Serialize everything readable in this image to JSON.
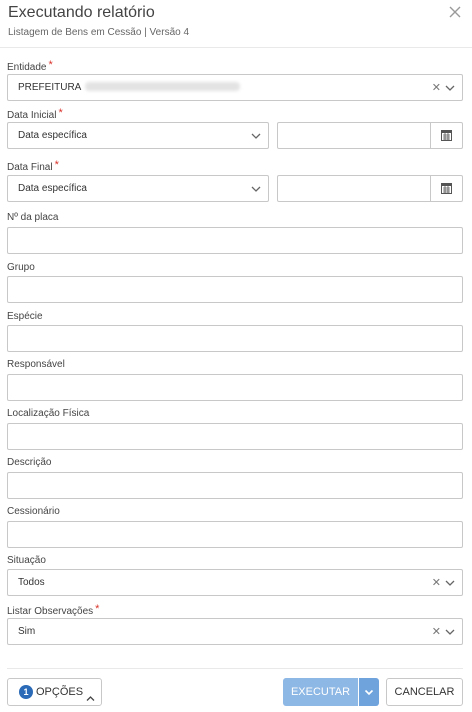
{
  "header": {
    "title": "Executando relatório",
    "subtitle": "Listagem de Bens em Cessão | Versão 4"
  },
  "fields": {
    "entidade": {
      "label": "Entidade",
      "required_mark": "*",
      "value": "PREFEITURA"
    },
    "data_inicial": {
      "label": "Data Inicial",
      "required_mark": "*",
      "type_value": "Data específica",
      "date_value": ""
    },
    "data_final": {
      "label": "Data Final",
      "required_mark": "*",
      "type_value": "Data específica",
      "date_value": ""
    },
    "placa": {
      "label": "Nº da placa",
      "value": ""
    },
    "grupo": {
      "label": "Grupo",
      "value": ""
    },
    "especie": {
      "label": "Espécie",
      "value": ""
    },
    "responsavel": {
      "label": "Responsável",
      "value": ""
    },
    "localizacao": {
      "label": "Localização Física",
      "value": ""
    },
    "descricao": {
      "label": "Descrição",
      "value": ""
    },
    "cessionario": {
      "label": "Cessionário",
      "value": ""
    },
    "situacao": {
      "label": "Situação",
      "value": "Todos"
    },
    "listar_obs": {
      "label": "Listar Observações",
      "required_mark": "*",
      "value": "Sim"
    }
  },
  "footer": {
    "options_badge": "1",
    "options_label": "OPÇÕES",
    "execute_label": "EXECUTAR",
    "cancel_label": "CANCELAR"
  },
  "icons": {
    "close": "close-icon",
    "clear": "clear-icon",
    "chevron": "chevron-down-icon",
    "calendar": "calendar-icon"
  },
  "colors": {
    "required": "#d9342b",
    "primary_disabled": "#8db7e4",
    "badge": "#2a6ab7"
  }
}
